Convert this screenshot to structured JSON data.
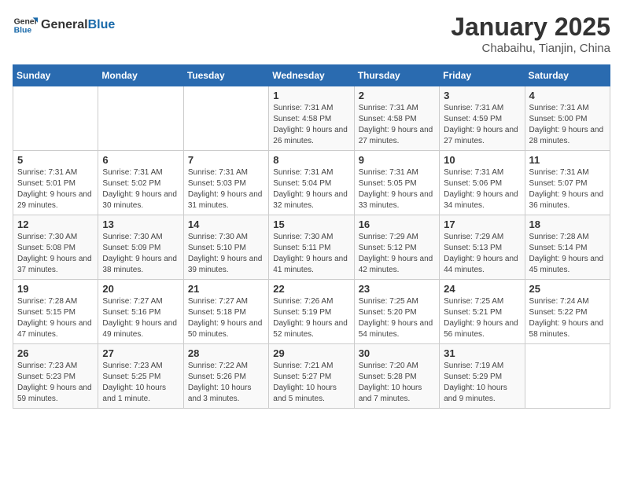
{
  "header": {
    "logo_general": "General",
    "logo_blue": "Blue",
    "title": "January 2025",
    "subtitle": "Chabaihu, Tianjin, China"
  },
  "weekdays": [
    "Sunday",
    "Monday",
    "Tuesday",
    "Wednesday",
    "Thursday",
    "Friday",
    "Saturday"
  ],
  "weeks": [
    [
      {
        "day": "",
        "info": ""
      },
      {
        "day": "",
        "info": ""
      },
      {
        "day": "",
        "info": ""
      },
      {
        "day": "1",
        "info": "Sunrise: 7:31 AM\nSunset: 4:58 PM\nDaylight: 9 hours and 26 minutes."
      },
      {
        "day": "2",
        "info": "Sunrise: 7:31 AM\nSunset: 4:58 PM\nDaylight: 9 hours and 27 minutes."
      },
      {
        "day": "3",
        "info": "Sunrise: 7:31 AM\nSunset: 4:59 PM\nDaylight: 9 hours and 27 minutes."
      },
      {
        "day": "4",
        "info": "Sunrise: 7:31 AM\nSunset: 5:00 PM\nDaylight: 9 hours and 28 minutes."
      }
    ],
    [
      {
        "day": "5",
        "info": "Sunrise: 7:31 AM\nSunset: 5:01 PM\nDaylight: 9 hours and 29 minutes."
      },
      {
        "day": "6",
        "info": "Sunrise: 7:31 AM\nSunset: 5:02 PM\nDaylight: 9 hours and 30 minutes."
      },
      {
        "day": "7",
        "info": "Sunrise: 7:31 AM\nSunset: 5:03 PM\nDaylight: 9 hours and 31 minutes."
      },
      {
        "day": "8",
        "info": "Sunrise: 7:31 AM\nSunset: 5:04 PM\nDaylight: 9 hours and 32 minutes."
      },
      {
        "day": "9",
        "info": "Sunrise: 7:31 AM\nSunset: 5:05 PM\nDaylight: 9 hours and 33 minutes."
      },
      {
        "day": "10",
        "info": "Sunrise: 7:31 AM\nSunset: 5:06 PM\nDaylight: 9 hours and 34 minutes."
      },
      {
        "day": "11",
        "info": "Sunrise: 7:31 AM\nSunset: 5:07 PM\nDaylight: 9 hours and 36 minutes."
      }
    ],
    [
      {
        "day": "12",
        "info": "Sunrise: 7:30 AM\nSunset: 5:08 PM\nDaylight: 9 hours and 37 minutes."
      },
      {
        "day": "13",
        "info": "Sunrise: 7:30 AM\nSunset: 5:09 PM\nDaylight: 9 hours and 38 minutes."
      },
      {
        "day": "14",
        "info": "Sunrise: 7:30 AM\nSunset: 5:10 PM\nDaylight: 9 hours and 39 minutes."
      },
      {
        "day": "15",
        "info": "Sunrise: 7:30 AM\nSunset: 5:11 PM\nDaylight: 9 hours and 41 minutes."
      },
      {
        "day": "16",
        "info": "Sunrise: 7:29 AM\nSunset: 5:12 PM\nDaylight: 9 hours and 42 minutes."
      },
      {
        "day": "17",
        "info": "Sunrise: 7:29 AM\nSunset: 5:13 PM\nDaylight: 9 hours and 44 minutes."
      },
      {
        "day": "18",
        "info": "Sunrise: 7:28 AM\nSunset: 5:14 PM\nDaylight: 9 hours and 45 minutes."
      }
    ],
    [
      {
        "day": "19",
        "info": "Sunrise: 7:28 AM\nSunset: 5:15 PM\nDaylight: 9 hours and 47 minutes."
      },
      {
        "day": "20",
        "info": "Sunrise: 7:27 AM\nSunset: 5:16 PM\nDaylight: 9 hours and 49 minutes."
      },
      {
        "day": "21",
        "info": "Sunrise: 7:27 AM\nSunset: 5:18 PM\nDaylight: 9 hours and 50 minutes."
      },
      {
        "day": "22",
        "info": "Sunrise: 7:26 AM\nSunset: 5:19 PM\nDaylight: 9 hours and 52 minutes."
      },
      {
        "day": "23",
        "info": "Sunrise: 7:25 AM\nSunset: 5:20 PM\nDaylight: 9 hours and 54 minutes."
      },
      {
        "day": "24",
        "info": "Sunrise: 7:25 AM\nSunset: 5:21 PM\nDaylight: 9 hours and 56 minutes."
      },
      {
        "day": "25",
        "info": "Sunrise: 7:24 AM\nSunset: 5:22 PM\nDaylight: 9 hours and 58 minutes."
      }
    ],
    [
      {
        "day": "26",
        "info": "Sunrise: 7:23 AM\nSunset: 5:23 PM\nDaylight: 9 hours and 59 minutes."
      },
      {
        "day": "27",
        "info": "Sunrise: 7:23 AM\nSunset: 5:25 PM\nDaylight: 10 hours and 1 minute."
      },
      {
        "day": "28",
        "info": "Sunrise: 7:22 AM\nSunset: 5:26 PM\nDaylight: 10 hours and 3 minutes."
      },
      {
        "day": "29",
        "info": "Sunrise: 7:21 AM\nSunset: 5:27 PM\nDaylight: 10 hours and 5 minutes."
      },
      {
        "day": "30",
        "info": "Sunrise: 7:20 AM\nSunset: 5:28 PM\nDaylight: 10 hours and 7 minutes."
      },
      {
        "day": "31",
        "info": "Sunrise: 7:19 AM\nSunset: 5:29 PM\nDaylight: 10 hours and 9 minutes."
      },
      {
        "day": "",
        "info": ""
      }
    ]
  ]
}
